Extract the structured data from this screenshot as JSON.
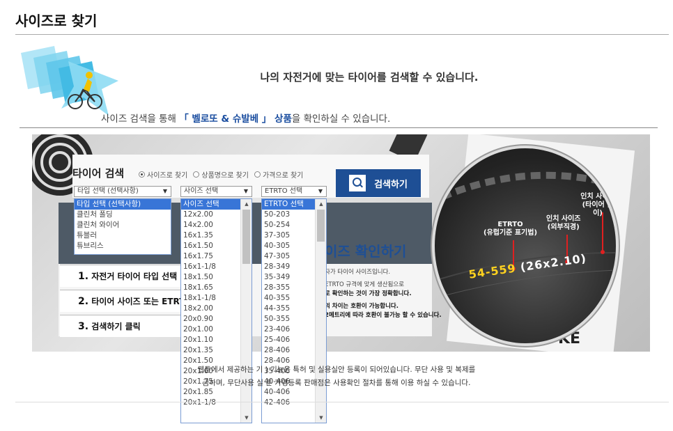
{
  "page_title": "사이즈로 찾기",
  "hero": {
    "main_text": "나의 자전거에 맞는 타이어를 검색할 수 있습니다.",
    "sub_prefix": "사이즈 검색을 통해 ",
    "sub_highlight": "「 벨로또 & 슈발베 」 상품",
    "sub_suffix": "을 확인하실 수 있습니다."
  },
  "search": {
    "title": "타이어 검색",
    "radios": [
      {
        "label": "사이즈로 찾기",
        "checked": true
      },
      {
        "label": "상품명으로 찾기",
        "checked": false
      },
      {
        "label": "가격으로 찾기",
        "checked": false
      }
    ],
    "button_label": "검색하기",
    "type_select": "타입 선택 (선택사항)",
    "size_select": "사이즈 선택",
    "etrto_select": "ETRTO 선택"
  },
  "type_options": [
    "타입 선택 (선택사항)",
    "클린처 폴딩",
    "클린처 와이어",
    "튜블러",
    "튜브리스"
  ],
  "size_options": [
    "사이즈 선택",
    "12x2.00",
    "14x2.00",
    "16x1.35",
    "16x1.50",
    "16x1.75",
    "16x1-1/8",
    "18x1.50",
    "18x1.65",
    "18x1-1/8",
    "18x2.00",
    "20x0.90",
    "20x1.00",
    "20x1.10",
    "20x1.35",
    "20x1.50",
    "20x1.60",
    "20x1.75",
    "20x1.85",
    "20x1-1/8"
  ],
  "etrto_options": [
    "ETRTO 선택",
    "50-203",
    "50-254",
    "37-305",
    "40-305",
    "47-305",
    "28-349",
    "35-349",
    "28-355",
    "40-355",
    "44-355",
    "50-355",
    "23-406",
    "25-406",
    "28-406",
    "28-406",
    "35-406",
    "40-406",
    "40-406",
    "42-406"
  ],
  "info": {
    "headline": "이즈 확인하기",
    "side_lines": [
      "자가 타이어 사이즈입니다.",
      "ETRTO 규격에 맞게 생산됨으로",
      "로 확인하는 것이 가장 정확합니다.",
      "의 차이는 호환이 가능합니다.",
      "2메트리에 따라 호환이 불가능 할 수 있습니다."
    ],
    "step1": "자전거 타이어 타입 선택",
    "step2_a": "타이어 사이즈",
    "step2_b": " 또는 ETRT",
    "step3": "검색하기 클릭",
    "step1_num": "1.",
    "step2_num": "2.",
    "step3_num": "3."
  },
  "magnifier": {
    "label_etrto": "ETRTO",
    "label_etrto_sub": "(유럽기준 표기법)",
    "label_inch": "인치 사이즈",
    "label_inch_sub": "(외부직경)",
    "label_width": "인치 사이즈",
    "label_width_sub": "(타이어 넓이)",
    "code_etrto": "54-559",
    "code_inch": "(26x2.10)"
  },
  "footer": {
    "line1": "웹툰에서 제공하는 기 ) 기능은 특허 및 실용실안 등록이 되어있습니다. 무단 사용 및 복제를",
    "line2": "금하며, 무단사용 실 툰 가맹등록 판매점은 사용확인 절차를 통해 이용 하실 수 있습니다."
  },
  "colors": {
    "accent": "#1e4f95",
    "selected": "#3875d7",
    "highlight": "#ffd21f"
  }
}
